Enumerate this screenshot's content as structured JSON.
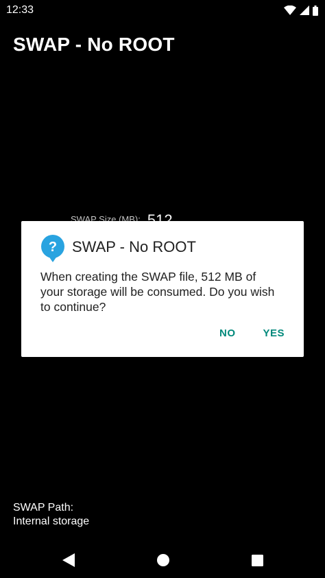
{
  "status_bar": {
    "time": "12:33",
    "icons": [
      "wifi-icon",
      "signal-icon",
      "battery-icon"
    ]
  },
  "app": {
    "title": "SWAP - No ROOT"
  },
  "size_row": {
    "label": "SWAP Size (MB):",
    "value": "512"
  },
  "dialog": {
    "icon": "question-icon",
    "title": "SWAP - No ROOT",
    "message": "When creating the SWAP file, 512 MB of your storage will be consumed. Do you wish to continue?",
    "buttons": {
      "no": "NO",
      "yes": "YES"
    }
  },
  "path": {
    "label": "SWAP Path:",
    "value": "Internal storage"
  },
  "nav_bar": {
    "icons": [
      "back-icon",
      "home-icon",
      "recents-icon"
    ]
  },
  "colors": {
    "background": "#000000",
    "dialog_background": "#ffffff",
    "accent": "#00897b",
    "icon_blue": "#29a3e0"
  }
}
